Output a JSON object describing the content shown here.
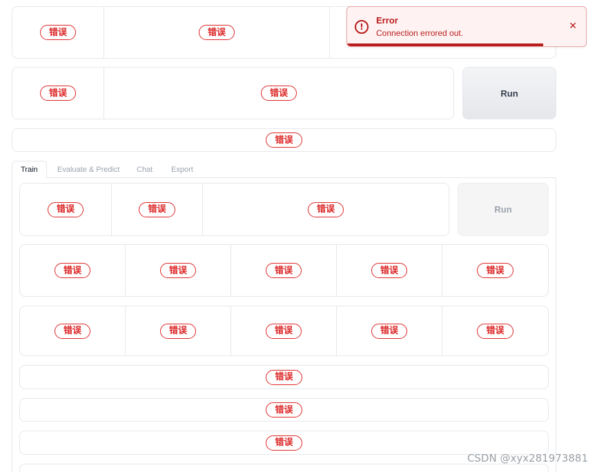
{
  "error_badge": "错误",
  "run_button": {
    "label": "Run"
  },
  "run_button_disabled": {
    "label": "Run"
  },
  "tabs": [
    {
      "label": "Train",
      "active": true
    },
    {
      "label": "Evaluate & Predict",
      "active": false
    },
    {
      "label": "Chat",
      "active": false
    },
    {
      "label": "Export",
      "active": false
    }
  ],
  "toast": {
    "title": "Error",
    "message": "Connection errored out.",
    "close_icon": "close-icon",
    "alert_icon": "alert-circle-icon",
    "progress": 0.82,
    "color": "#b91c1c"
  },
  "watermark": "CSDN @xyx281973881",
  "colors": {
    "error": "#dc2626",
    "border": "#e5e7eb"
  }
}
